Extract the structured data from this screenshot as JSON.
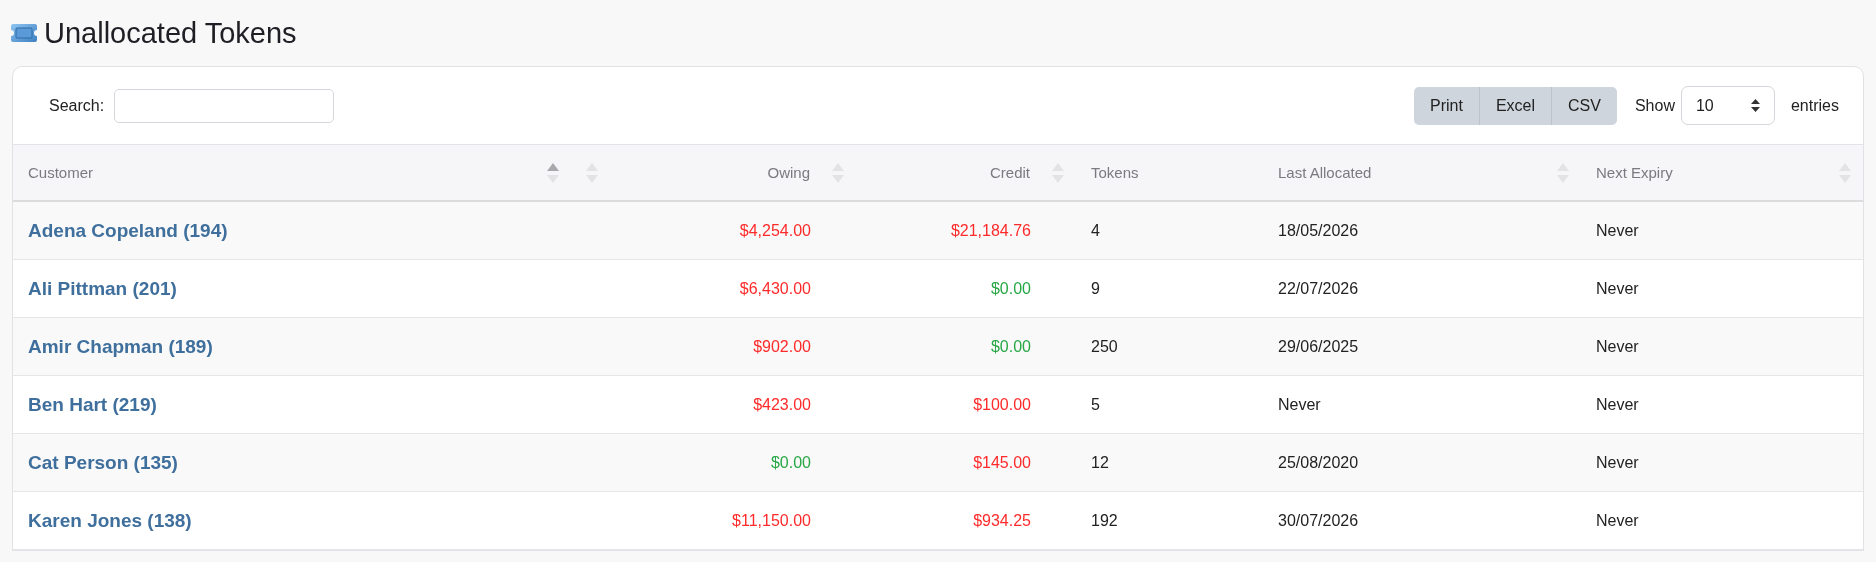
{
  "page": {
    "title": "Unallocated Tokens"
  },
  "toolbar": {
    "search_label": "Search:",
    "export_buttons": [
      "Print",
      "Excel",
      "CSV"
    ],
    "show_label": "Show",
    "page_size": "10",
    "entries_label": "entries"
  },
  "table": {
    "columns": [
      {
        "label": "Customer",
        "sorted": true
      },
      {
        "sorted": false
      },
      {
        "label": "Owing",
        "sorted": false
      },
      {
        "label": "Credit",
        "sorted": false
      },
      {
        "label": "Tokens"
      },
      {
        "label": "Last Allocated",
        "sorted": false
      },
      {
        "label": "Next Expiry",
        "sorted": false
      }
    ],
    "rows": [
      {
        "customer": "Adena Copeland (194)",
        "owing": {
          "text": "$4,254.00",
          "color": "#ff2a2a"
        },
        "credit": {
          "text": "$21,184.76",
          "color": "#ff2a2a"
        },
        "tokens": "4",
        "last_allocated": "18/05/2026",
        "next_expiry": "Never"
      },
      {
        "customer": "Ali Pittman (201)",
        "owing": {
          "text": "$6,430.00",
          "color": "#ff2a2a"
        },
        "credit": {
          "text": "$0.00",
          "color": "#28a745"
        },
        "tokens": "9",
        "last_allocated": "22/07/2026",
        "next_expiry": "Never"
      },
      {
        "customer": "Amir Chapman (189)",
        "owing": {
          "text": "$902.00",
          "color": "#ff2a2a"
        },
        "credit": {
          "text": "$0.00",
          "color": "#28a745"
        },
        "tokens": "250",
        "last_allocated": "29/06/2025",
        "next_expiry": "Never"
      },
      {
        "customer": "Ben Hart (219)",
        "owing": {
          "text": "$423.00",
          "color": "#ff2a2a"
        },
        "credit": {
          "text": "$100.00",
          "color": "#ff2a2a"
        },
        "tokens": "5",
        "last_allocated": "Never",
        "next_expiry": "Never"
      },
      {
        "customer": "Cat Person (135)",
        "owing": {
          "text": "$0.00",
          "color": "#28a745"
        },
        "credit": {
          "text": "$145.00",
          "color": "#ff2a2a"
        },
        "tokens": "12",
        "last_allocated": "25/08/2020",
        "next_expiry": "Never"
      },
      {
        "customer": "Karen Jones (138)",
        "owing": {
          "text": "$11,150.00",
          "color": "#ff2a2a"
        },
        "credit": {
          "text": "$934.25",
          "color": "#ff2a2a"
        },
        "tokens": "192",
        "last_allocated": "30/07/2026",
        "next_expiry": "Never"
      }
    ]
  }
}
